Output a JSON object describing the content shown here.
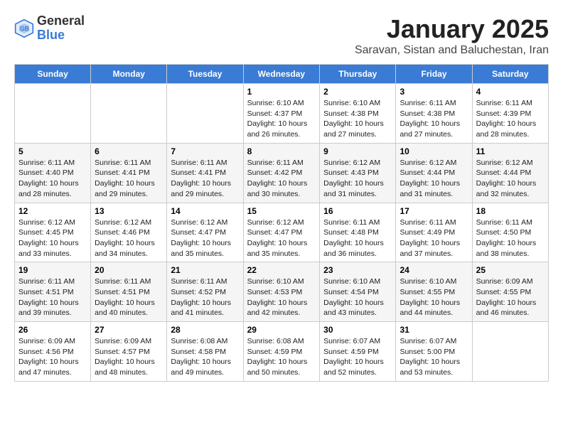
{
  "header": {
    "logo_general": "General",
    "logo_blue": "Blue",
    "month_title": "January 2025",
    "subtitle": "Saravan, Sistan and Baluchestan, Iran"
  },
  "days_of_week": [
    "Sunday",
    "Monday",
    "Tuesday",
    "Wednesday",
    "Thursday",
    "Friday",
    "Saturday"
  ],
  "weeks": [
    [
      {
        "day": "",
        "info": ""
      },
      {
        "day": "",
        "info": ""
      },
      {
        "day": "",
        "info": ""
      },
      {
        "day": "1",
        "info": "Sunrise: 6:10 AM\nSunset: 4:37 PM\nDaylight: 10 hours\nand 26 minutes."
      },
      {
        "day": "2",
        "info": "Sunrise: 6:10 AM\nSunset: 4:38 PM\nDaylight: 10 hours\nand 27 minutes."
      },
      {
        "day": "3",
        "info": "Sunrise: 6:11 AM\nSunset: 4:38 PM\nDaylight: 10 hours\nand 27 minutes."
      },
      {
        "day": "4",
        "info": "Sunrise: 6:11 AM\nSunset: 4:39 PM\nDaylight: 10 hours\nand 28 minutes."
      }
    ],
    [
      {
        "day": "5",
        "info": "Sunrise: 6:11 AM\nSunset: 4:40 PM\nDaylight: 10 hours\nand 28 minutes."
      },
      {
        "day": "6",
        "info": "Sunrise: 6:11 AM\nSunset: 4:41 PM\nDaylight: 10 hours\nand 29 minutes."
      },
      {
        "day": "7",
        "info": "Sunrise: 6:11 AM\nSunset: 4:41 PM\nDaylight: 10 hours\nand 29 minutes."
      },
      {
        "day": "8",
        "info": "Sunrise: 6:11 AM\nSunset: 4:42 PM\nDaylight: 10 hours\nand 30 minutes."
      },
      {
        "day": "9",
        "info": "Sunrise: 6:12 AM\nSunset: 4:43 PM\nDaylight: 10 hours\nand 31 minutes."
      },
      {
        "day": "10",
        "info": "Sunrise: 6:12 AM\nSunset: 4:44 PM\nDaylight: 10 hours\nand 31 minutes."
      },
      {
        "day": "11",
        "info": "Sunrise: 6:12 AM\nSunset: 4:44 PM\nDaylight: 10 hours\nand 32 minutes."
      }
    ],
    [
      {
        "day": "12",
        "info": "Sunrise: 6:12 AM\nSunset: 4:45 PM\nDaylight: 10 hours\nand 33 minutes."
      },
      {
        "day": "13",
        "info": "Sunrise: 6:12 AM\nSunset: 4:46 PM\nDaylight: 10 hours\nand 34 minutes."
      },
      {
        "day": "14",
        "info": "Sunrise: 6:12 AM\nSunset: 4:47 PM\nDaylight: 10 hours\nand 35 minutes."
      },
      {
        "day": "15",
        "info": "Sunrise: 6:12 AM\nSunset: 4:47 PM\nDaylight: 10 hours\nand 35 minutes."
      },
      {
        "day": "16",
        "info": "Sunrise: 6:11 AM\nSunset: 4:48 PM\nDaylight: 10 hours\nand 36 minutes."
      },
      {
        "day": "17",
        "info": "Sunrise: 6:11 AM\nSunset: 4:49 PM\nDaylight: 10 hours\nand 37 minutes."
      },
      {
        "day": "18",
        "info": "Sunrise: 6:11 AM\nSunset: 4:50 PM\nDaylight: 10 hours\nand 38 minutes."
      }
    ],
    [
      {
        "day": "19",
        "info": "Sunrise: 6:11 AM\nSunset: 4:51 PM\nDaylight: 10 hours\nand 39 minutes."
      },
      {
        "day": "20",
        "info": "Sunrise: 6:11 AM\nSunset: 4:51 PM\nDaylight: 10 hours\nand 40 minutes."
      },
      {
        "day": "21",
        "info": "Sunrise: 6:11 AM\nSunset: 4:52 PM\nDaylight: 10 hours\nand 41 minutes."
      },
      {
        "day": "22",
        "info": "Sunrise: 6:10 AM\nSunset: 4:53 PM\nDaylight: 10 hours\nand 42 minutes."
      },
      {
        "day": "23",
        "info": "Sunrise: 6:10 AM\nSunset: 4:54 PM\nDaylight: 10 hours\nand 43 minutes."
      },
      {
        "day": "24",
        "info": "Sunrise: 6:10 AM\nSunset: 4:55 PM\nDaylight: 10 hours\nand 44 minutes."
      },
      {
        "day": "25",
        "info": "Sunrise: 6:09 AM\nSunset: 4:55 PM\nDaylight: 10 hours\nand 46 minutes."
      }
    ],
    [
      {
        "day": "26",
        "info": "Sunrise: 6:09 AM\nSunset: 4:56 PM\nDaylight: 10 hours\nand 47 minutes."
      },
      {
        "day": "27",
        "info": "Sunrise: 6:09 AM\nSunset: 4:57 PM\nDaylight: 10 hours\nand 48 minutes."
      },
      {
        "day": "28",
        "info": "Sunrise: 6:08 AM\nSunset: 4:58 PM\nDaylight: 10 hours\nand 49 minutes."
      },
      {
        "day": "29",
        "info": "Sunrise: 6:08 AM\nSunset: 4:59 PM\nDaylight: 10 hours\nand 50 minutes."
      },
      {
        "day": "30",
        "info": "Sunrise: 6:07 AM\nSunset: 4:59 PM\nDaylight: 10 hours\nand 52 minutes."
      },
      {
        "day": "31",
        "info": "Sunrise: 6:07 AM\nSunset: 5:00 PM\nDaylight: 10 hours\nand 53 minutes."
      },
      {
        "day": "",
        "info": ""
      }
    ]
  ]
}
